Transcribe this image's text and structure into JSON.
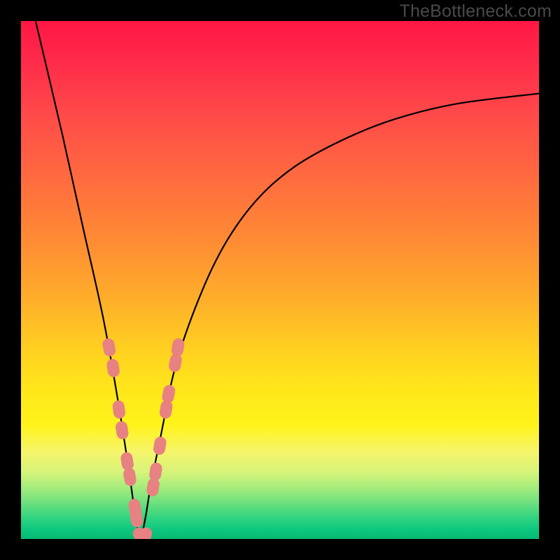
{
  "watermark": "TheBottleneck.com",
  "colors": {
    "frame": "#000000",
    "marker": "#e88282",
    "curve": "#000000"
  },
  "chart_data": {
    "type": "line",
    "title": "",
    "xlabel": "",
    "ylabel": "",
    "xlim": [
      0,
      100
    ],
    "ylim": [
      0,
      100
    ],
    "grid": false,
    "legend": false,
    "series": [
      {
        "name": "bottleneck-curve",
        "comment": "V-shaped curve; x is normalized 0-100 left-to-right across plot, y is 0 at bottom to 100 at top (bottleneck percentage). Minimum near x≈23.",
        "x": [
          0,
          4,
          8,
          12,
          16,
          19,
          21,
          22,
          23,
          24,
          25,
          27,
          30,
          35,
          40,
          46,
          53,
          62,
          72,
          84,
          100
        ],
        "y": [
          112,
          95,
          78,
          60,
          42,
          25,
          12,
          5,
          0,
          4,
          10,
          20,
          34,
          48,
          58,
          66,
          72,
          77,
          81,
          84,
          86
        ]
      }
    ],
    "markers": {
      "comment": "Pink capsule markers clustered near the trough of the curve",
      "points": [
        {
          "x": 17.0,
          "y": 37
        },
        {
          "x": 17.8,
          "y": 33
        },
        {
          "x": 18.9,
          "y": 25
        },
        {
          "x": 19.5,
          "y": 21
        },
        {
          "x": 20.5,
          "y": 15
        },
        {
          "x": 21.0,
          "y": 12
        },
        {
          "x": 22.0,
          "y": 6
        },
        {
          "x": 22.3,
          "y": 4
        },
        {
          "x": 23.0,
          "y": 0.5
        },
        {
          "x": 24.0,
          "y": 0.5
        },
        {
          "x": 25.5,
          "y": 10
        },
        {
          "x": 26.0,
          "y": 13
        },
        {
          "x": 26.8,
          "y": 18
        },
        {
          "x": 28.0,
          "y": 25
        },
        {
          "x": 28.5,
          "y": 28
        },
        {
          "x": 29.8,
          "y": 34
        },
        {
          "x": 30.3,
          "y": 37
        }
      ]
    }
  }
}
